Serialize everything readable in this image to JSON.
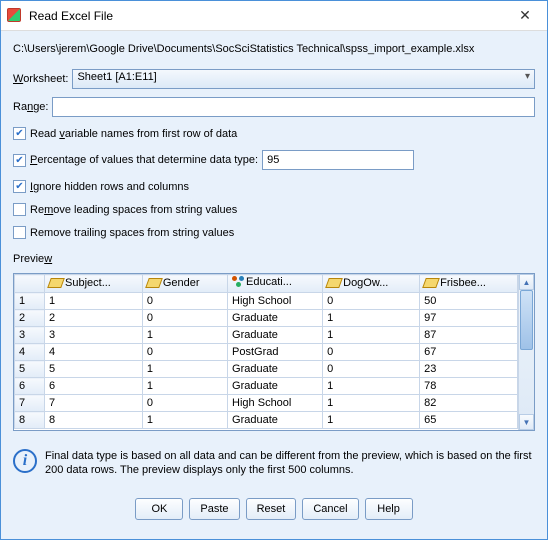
{
  "window": {
    "title": "Read Excel File"
  },
  "filepath": "C:\\Users\\jerem\\Google Drive\\Documents\\SocSciStatistics Technical\\spss_import_example.xlsx",
  "labels": {
    "worksheet": "Worksheet:",
    "range": "Range:",
    "read_varnames": "Read variable names from first row of data",
    "pct_values": "Percentage of values that determine data type:",
    "ignore_hidden": "Ignore hidden rows and columns",
    "remove_leading": "Remove leading spaces from string values",
    "remove_trailing": "Remove trailing spaces from string values",
    "preview": "Preview"
  },
  "worksheet_value": "Sheet1 [A1:E11]",
  "range_value": "",
  "pct_value": "95",
  "checks": {
    "read_varnames": true,
    "pct_values": true,
    "ignore_hidden": true,
    "remove_leading": false,
    "remove_trailing": false
  },
  "columns": [
    "Subject...",
    "Gender",
    "Educati...",
    "DogOw...",
    "Frisbee..."
  ],
  "col_icons": [
    "ruler",
    "ruler",
    "nominal",
    "ruler",
    "ruler"
  ],
  "rows": [
    {
      "n": "1",
      "c": [
        "1",
        "0",
        "High School",
        "0",
        "50"
      ]
    },
    {
      "n": "2",
      "c": [
        "2",
        "0",
        "Graduate",
        "1",
        "97"
      ]
    },
    {
      "n": "3",
      "c": [
        "3",
        "1",
        "Graduate",
        "1",
        "87"
      ]
    },
    {
      "n": "4",
      "c": [
        "4",
        "0",
        "PostGrad",
        "0",
        "67"
      ]
    },
    {
      "n": "5",
      "c": [
        "5",
        "1",
        "Graduate",
        "0",
        "23"
      ]
    },
    {
      "n": "6",
      "c": [
        "6",
        "1",
        "Graduate",
        "1",
        "78"
      ]
    },
    {
      "n": "7",
      "c": [
        "7",
        "0",
        "High School",
        "1",
        "82"
      ]
    },
    {
      "n": "8",
      "c": [
        "8",
        "1",
        "Graduate",
        "1",
        "65"
      ]
    }
  ],
  "info": "Final data type is based on all data and can be different from the preview, which is based on the first 200 data rows. The preview displays only the first 500 columns.",
  "buttons": {
    "ok": "OK",
    "paste": "Paste",
    "reset": "Reset",
    "cancel": "Cancel",
    "help": "Help"
  }
}
